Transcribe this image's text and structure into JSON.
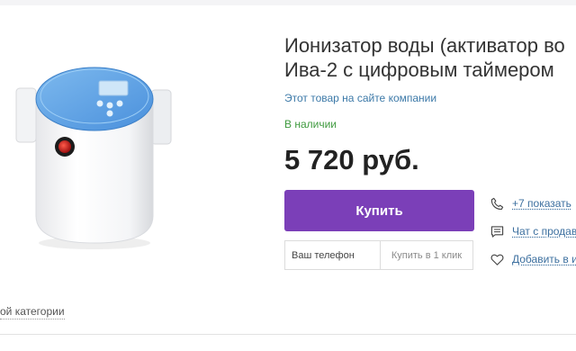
{
  "product": {
    "title_line1": "Ионизатор воды (активатор во",
    "title_line2": "Ива-2 с цифровым таймером",
    "image_alt": "Ионизатор воды Ива-2",
    "company_link": "Этот товар на сайте компании",
    "availability": "В наличии",
    "price": "5 720 руб."
  },
  "purchase": {
    "buy_label": "Купить",
    "phone_placeholder": "Ваш телефон",
    "oneclick_label": "Купить в 1 клик"
  },
  "side_actions": [
    {
      "icon": "phone-icon",
      "label": "+7 показать"
    },
    {
      "icon": "chat-icon",
      "label": "Чат с продав"
    },
    {
      "icon": "heart-icon",
      "label": "Добавить в из"
    }
  ],
  "footer": {
    "category_link": "ой категории"
  },
  "colors": {
    "accent": "#7b3fb8",
    "link": "#3c79a8",
    "in_stock": "#3f9a3f",
    "device_blue": "#5aa2e6"
  }
}
